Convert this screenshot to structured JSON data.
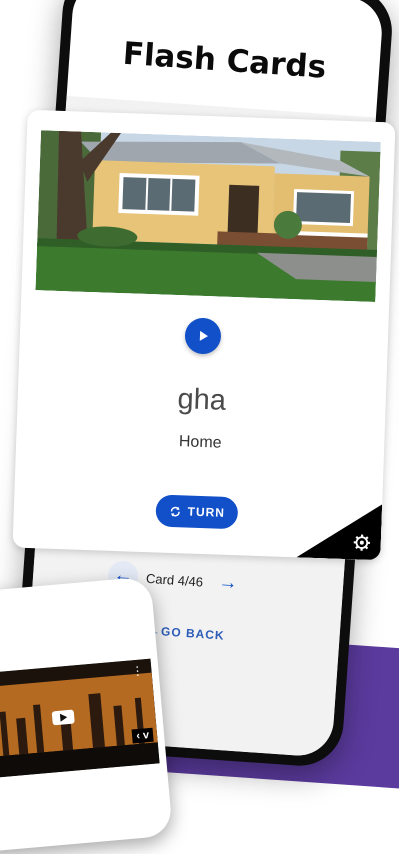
{
  "app": {
    "title": "Flash Cards"
  },
  "card": {
    "word": "gha",
    "meaning": "Home",
    "turn_label": "TURN",
    "image": "house-photo"
  },
  "navigation": {
    "counter": "Card 4/46",
    "go_back": "←GO BACK"
  },
  "colors": {
    "accent": "#1150c8",
    "frame": "#0d0d0d",
    "background_strip": "#5b3b9e"
  },
  "icons": [
    "play-icon",
    "turn-icon",
    "settings-icon",
    "arrow-left-icon",
    "arrow-right-icon"
  ]
}
